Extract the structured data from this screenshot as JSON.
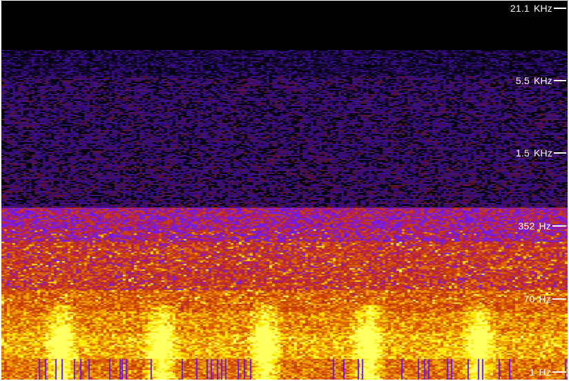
{
  "view": "spectrogram",
  "palette": [
    "#000000",
    "#3a0a8a",
    "#6a14ff",
    "#7a1fe0",
    "#b41e5a",
    "#c83c0a",
    "#dc6400",
    "#f0a000",
    "#ffe600",
    "#ffff60"
  ],
  "frequency_axis": {
    "scale": "log",
    "range": [
      "1 Hz",
      "21.1 KHz"
    ],
    "ticks": [
      {
        "value": "21.1",
        "unit": "KHz"
      },
      {
        "value": "5.5",
        "unit": "KHz"
      },
      {
        "value": "1.5",
        "unit": "KHz"
      },
      {
        "value": "352",
        "unit": "Hz"
      },
      {
        "value": "70",
        "unit": "Hz"
      },
      {
        "value": "1",
        "unit": "Hz"
      }
    ]
  }
}
